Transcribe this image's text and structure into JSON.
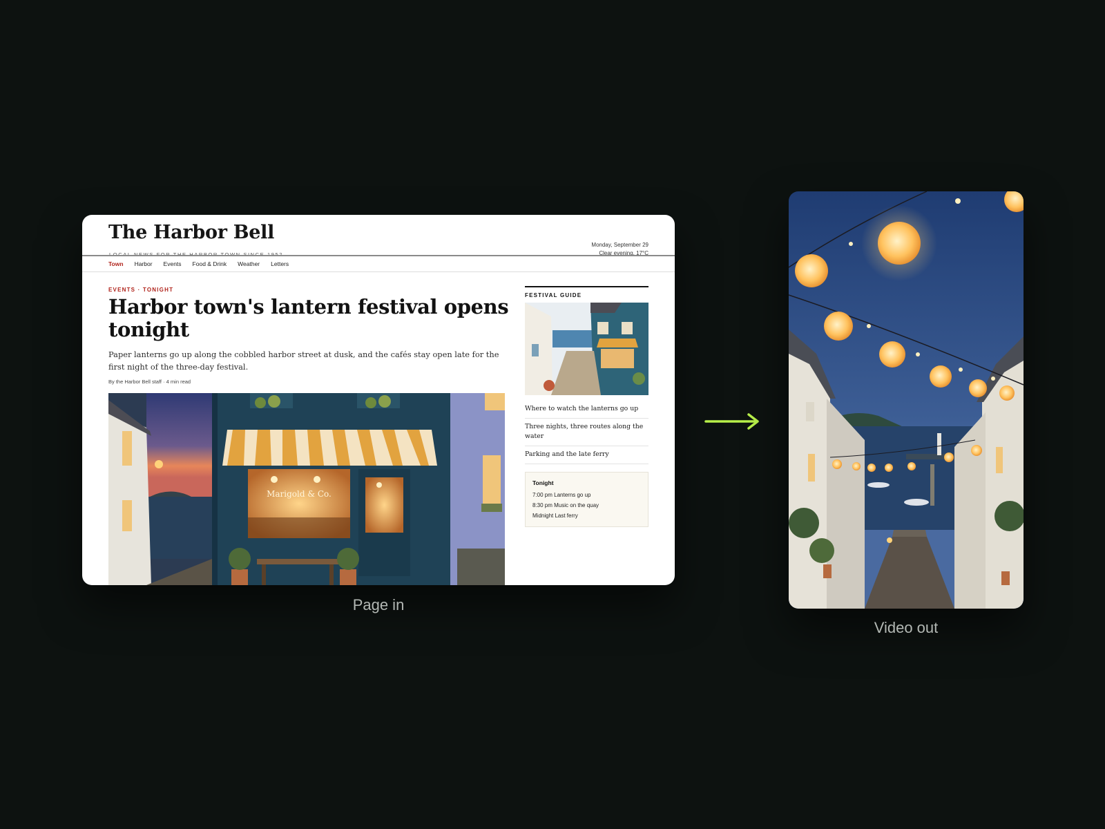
{
  "newspaper": {
    "name": "The Harbor Bell",
    "tagline": "LOCAL NEWS FOR THE HARBOR TOWN SINCE 1952",
    "date": "Monday, September 29",
    "weather": "Clear evening, 17°C",
    "nav": [
      "Town",
      "Harbor",
      "Events",
      "Food & Drink",
      "Weather",
      "Letters"
    ],
    "active_nav": "Town"
  },
  "article": {
    "kicker": "EVENTS · TONIGHT",
    "headline": "Harbor town's lantern festival opens tonight",
    "dek": "Paper lanterns go up along the cobbled harbor street at dusk, and the cafés stay open late for the first night of the three-day festival.",
    "byline": "By the Harbor Bell staff · 4 min read",
    "hero_sign": "Marigold & Co."
  },
  "sidebar": {
    "label": "FESTIVAL GUIDE",
    "links": [
      "Where to watch the lanterns go up",
      "Three nights, three routes along the water",
      "Parking and the late ferry"
    ],
    "schedule_title": "Tonight",
    "schedule": [
      "7:00 pm Lanterns go up",
      "8:30 pm Music on the quay",
      "Midnight Last ferry"
    ]
  },
  "captions": {
    "left": "Page in",
    "right": "Video out"
  },
  "colors": {
    "background": "#0d1210",
    "accent_red": "#b0231b",
    "arrow_green": "#b8f04a",
    "caption": "#b3b8b4"
  }
}
